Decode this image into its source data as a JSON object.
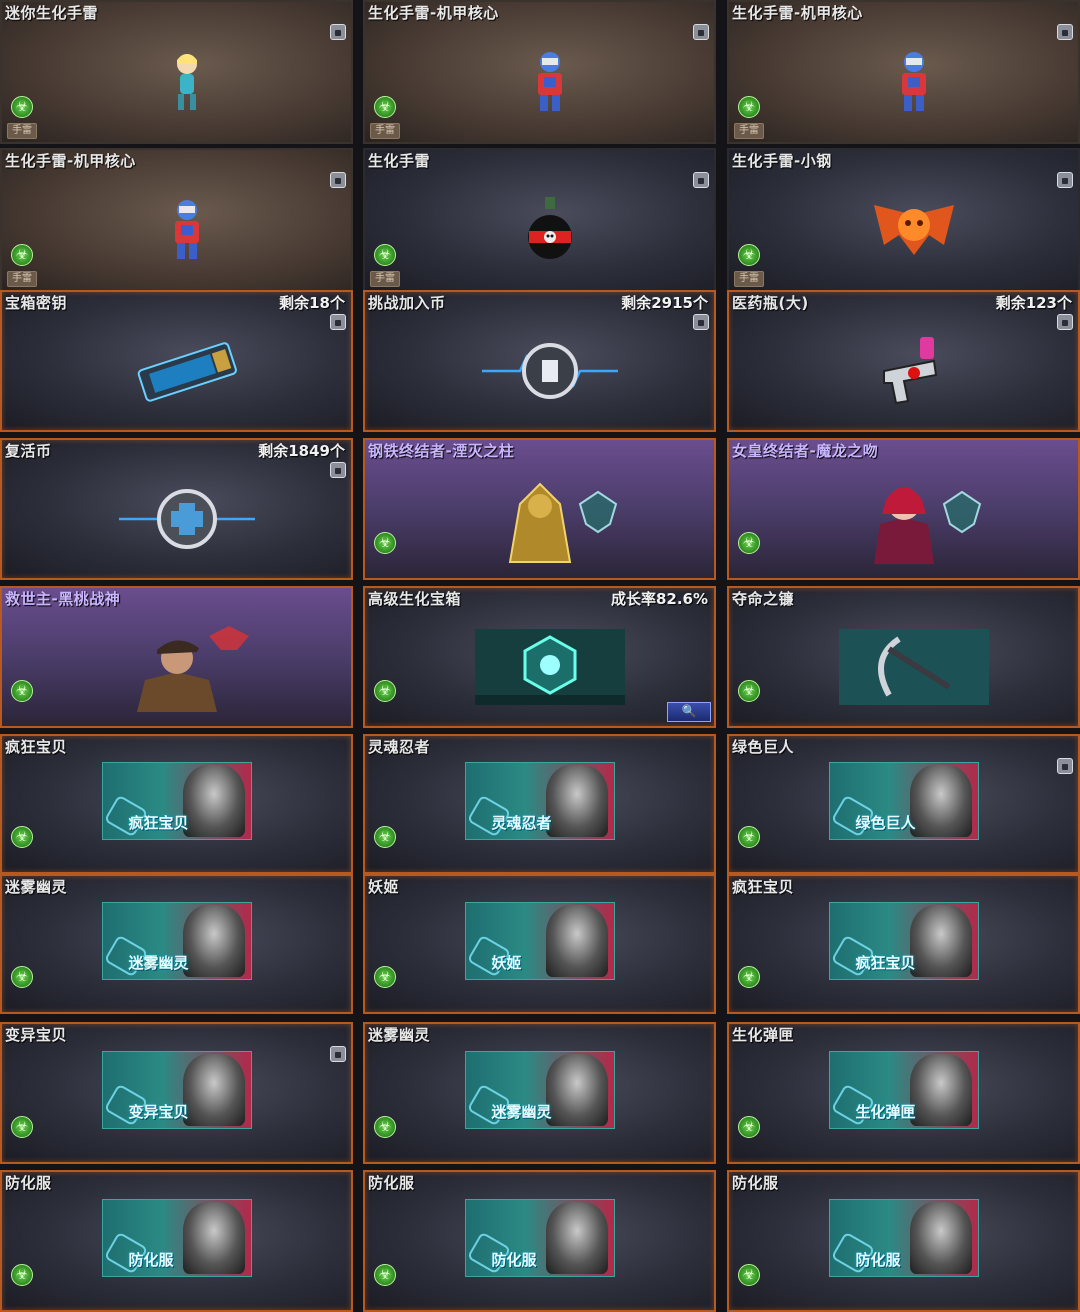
{
  "items": [
    {
      "title": "迷你生化手雷",
      "count": "",
      "lock": true,
      "bio": true,
      "tag": "手雷",
      "style": "brown",
      "icon": "mini-doll"
    },
    {
      "title": "生化手雷-机甲核心",
      "count": "",
      "lock": true,
      "bio": true,
      "tag": "手雷",
      "style": "brown",
      "icon": "mecha-doll"
    },
    {
      "title": "生化手雷-机甲核心",
      "count": "",
      "lock": true,
      "bio": true,
      "tag": "手雷",
      "style": "brown",
      "icon": "mecha-doll"
    },
    {
      "title": "生化手雷-机甲核心",
      "count": "",
      "lock": true,
      "bio": true,
      "tag": "手雷",
      "style": "brown",
      "icon": "mecha-doll"
    },
    {
      "title": "生化手雷",
      "count": "",
      "lock": true,
      "bio": true,
      "tag": "手雷",
      "style": "dark",
      "icon": "skull-grenade"
    },
    {
      "title": "生化手雷-小钢",
      "count": "",
      "lock": true,
      "bio": true,
      "tag": "手雷",
      "style": "dark",
      "icon": "orange-bat"
    },
    {
      "title": "宝箱密钥",
      "count": "剩余18个",
      "lock": true,
      "bio": false,
      "tag": "",
      "style": "orange",
      "icon": "key-card"
    },
    {
      "title": "挑战加入币",
      "count": "剩余2915个",
      "lock": true,
      "bio": false,
      "tag": "",
      "style": "orange",
      "icon": "challenge-coin"
    },
    {
      "title": "医药瓶(大)",
      "count": "剩余123个",
      "lock": true,
      "bio": false,
      "tag": "",
      "style": "orange",
      "icon": "medicine-gun"
    },
    {
      "title": "复活币",
      "count": "剩余1849个",
      "lock": true,
      "bio": false,
      "tag": "",
      "style": "orange",
      "icon": "revive-coin"
    },
    {
      "title": "钢铁终结者-湮灭之柱",
      "count": "",
      "lock": false,
      "bio": true,
      "tag": "",
      "style": "purple",
      "icon": "gold-armor"
    },
    {
      "title": "女皇终结者-魔龙之吻",
      "count": "",
      "lock": false,
      "bio": true,
      "tag": "",
      "style": "purple",
      "icon": "red-queen"
    },
    {
      "title": "救世主-黑桃战神",
      "count": "",
      "lock": false,
      "bio": true,
      "tag": "",
      "style": "purple",
      "icon": "soldier"
    },
    {
      "title": "高级生化宝箱",
      "count": "成长率82.6%",
      "lock": false,
      "bio": true,
      "tag": "",
      "style": "orange",
      "icon": "bio-box",
      "zoom": true
    },
    {
      "title": "夺命之镰",
      "count": "",
      "lock": false,
      "bio": true,
      "tag": "",
      "style": "orange",
      "icon": "scythe"
    },
    {
      "title": "疯狂宝贝",
      "count": "",
      "lock": false,
      "bio": true,
      "tag": "",
      "style": "orange",
      "icon": "banner",
      "banner": "疯狂宝贝"
    },
    {
      "title": "灵魂忍者",
      "count": "",
      "lock": false,
      "bio": true,
      "tag": "",
      "style": "orange",
      "icon": "banner",
      "banner": "灵魂忍者"
    },
    {
      "title": "绿色巨人",
      "count": "",
      "lock": true,
      "bio": true,
      "tag": "",
      "style": "orange",
      "icon": "banner",
      "banner": "绿色巨人"
    },
    {
      "title": "迷雾幽灵",
      "count": "",
      "lock": false,
      "bio": true,
      "tag": "",
      "style": "orange",
      "icon": "banner",
      "banner": "迷雾幽灵"
    },
    {
      "title": "妖姬",
      "count": "",
      "lock": false,
      "bio": true,
      "tag": "",
      "style": "orange",
      "icon": "banner",
      "banner": "妖姬"
    },
    {
      "title": "疯狂宝贝",
      "count": "",
      "lock": false,
      "bio": true,
      "tag": "",
      "style": "orange",
      "icon": "banner",
      "banner": "疯狂宝贝"
    },
    {
      "title": "变异宝贝",
      "count": "",
      "lock": true,
      "bio": true,
      "tag": "",
      "style": "orange",
      "icon": "banner",
      "banner": "变异宝贝"
    },
    {
      "title": "迷雾幽灵",
      "count": "",
      "lock": false,
      "bio": true,
      "tag": "",
      "style": "orange",
      "icon": "banner",
      "banner": "迷雾幽灵"
    },
    {
      "title": "生化弹匣",
      "count": "",
      "lock": false,
      "bio": true,
      "tag": "",
      "style": "orange",
      "icon": "banner",
      "banner": "生化弹匣"
    },
    {
      "title": "防化服",
      "count": "",
      "lock": false,
      "bio": true,
      "tag": "",
      "style": "orange",
      "icon": "banner",
      "banner": "防化服"
    },
    {
      "title": "防化服",
      "count": "",
      "lock": false,
      "bio": true,
      "tag": "",
      "style": "orange",
      "icon": "banner",
      "banner": "防化服"
    },
    {
      "title": "防化服",
      "count": "",
      "lock": false,
      "bio": true,
      "tag": "",
      "style": "orange",
      "icon": "banner",
      "banner": "防化服"
    }
  ],
  "zoom_label": "🔍",
  "bio_glyph": "☣"
}
